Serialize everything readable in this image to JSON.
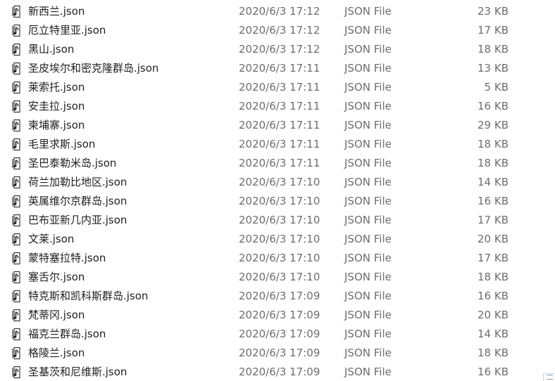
{
  "file_icon": "json-file-icon",
  "files": [
    {
      "name": "新西兰.json",
      "date": "2020/6/3 17:12",
      "type": "JSON File",
      "size": "23 KB"
    },
    {
      "name": "厄立特里亚.json",
      "date": "2020/6/3 17:12",
      "type": "JSON File",
      "size": "17 KB"
    },
    {
      "name": "黑山.json",
      "date": "2020/6/3 17:12",
      "type": "JSON File",
      "size": "18 KB"
    },
    {
      "name": "圣皮埃尔和密克隆群岛.json",
      "date": "2020/6/3 17:11",
      "type": "JSON File",
      "size": "13 KB"
    },
    {
      "name": "莱索托.json",
      "date": "2020/6/3 17:11",
      "type": "JSON File",
      "size": "5 KB"
    },
    {
      "name": "安圭拉.json",
      "date": "2020/6/3 17:11",
      "type": "JSON File",
      "size": "16 KB"
    },
    {
      "name": "柬埔寨.json",
      "date": "2020/6/3 17:11",
      "type": "JSON File",
      "size": "29 KB"
    },
    {
      "name": "毛里求斯.json",
      "date": "2020/6/3 17:11",
      "type": "JSON File",
      "size": "18 KB"
    },
    {
      "name": "圣巴泰勒米岛.json",
      "date": "2020/6/3 17:11",
      "type": "JSON File",
      "size": "18 KB"
    },
    {
      "name": "荷兰加勒比地区.json",
      "date": "2020/6/3 17:10",
      "type": "JSON File",
      "size": "14 KB"
    },
    {
      "name": "英属维尔京群岛.json",
      "date": "2020/6/3 17:10",
      "type": "JSON File",
      "size": "16 KB"
    },
    {
      "name": "巴布亚新几内亚.json",
      "date": "2020/6/3 17:10",
      "type": "JSON File",
      "size": "17 KB"
    },
    {
      "name": "文莱.json",
      "date": "2020/6/3 17:10",
      "type": "JSON File",
      "size": "20 KB"
    },
    {
      "name": "蒙特塞拉特.json",
      "date": "2020/6/3 17:10",
      "type": "JSON File",
      "size": "17 KB"
    },
    {
      "name": "塞舌尔.json",
      "date": "2020/6/3 17:10",
      "type": "JSON File",
      "size": "18 KB"
    },
    {
      "name": "特克斯和凯科斯群岛.json",
      "date": "2020/6/3 17:09",
      "type": "JSON File",
      "size": "16 KB"
    },
    {
      "name": "梵蒂冈.json",
      "date": "2020/6/3 17:09",
      "type": "JSON File",
      "size": "20 KB"
    },
    {
      "name": "福克兰群岛.json",
      "date": "2020/6/3 17:09",
      "type": "JSON File",
      "size": "14 KB"
    },
    {
      "name": "格陵兰.json",
      "date": "2020/6/3 17:09",
      "type": "JSON File",
      "size": "18 KB"
    },
    {
      "name": "圣基茨和尼维斯.json",
      "date": "2020/6/3 17:09",
      "type": "JSON File",
      "size": "16 KB"
    }
  ]
}
